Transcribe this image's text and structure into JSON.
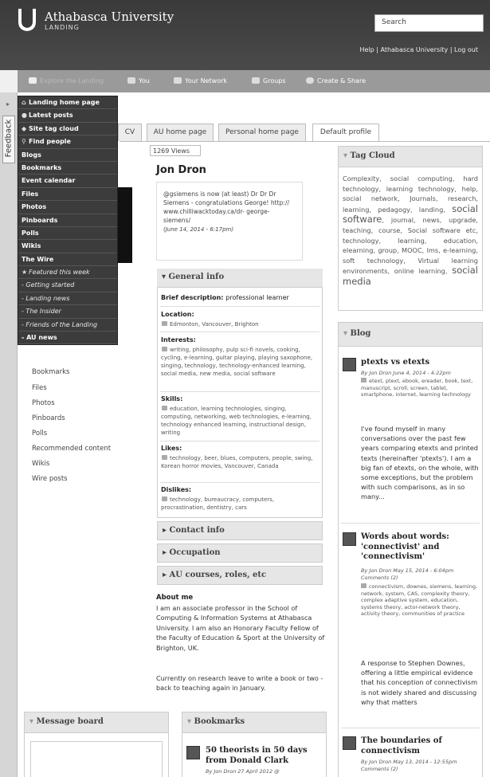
{
  "header": {
    "brand_name": "Athabasca University",
    "brand_sub": "LANDING",
    "search_placeholder": "Search",
    "top_links": "Help | Athabasca University | Log out"
  },
  "navbar": {
    "items": [
      "Explore the Landing",
      "You",
      "Your Network",
      "Groups",
      "Create & Share"
    ]
  },
  "feedback_label": "Feedback",
  "menu": {
    "items": [
      {
        "label": "Landing home page",
        "icon": "home-icon",
        "glyph": "⌂"
      },
      {
        "label": "Latest posts",
        "icon": "speech-bubble-icon",
        "glyph": "●"
      },
      {
        "label": "Site tag cloud",
        "icon": "tag-icon",
        "glyph": "◆"
      },
      {
        "label": "Find people",
        "icon": "search-icon",
        "glyph": "⚲"
      },
      {
        "label": "Blogs"
      },
      {
        "label": "Bookmarks"
      },
      {
        "label": "Event calendar"
      },
      {
        "label": "Files"
      },
      {
        "label": "Photos"
      },
      {
        "label": "Pinboards"
      },
      {
        "label": "Polls"
      },
      {
        "label": "Wikis"
      },
      {
        "label": "The Wire"
      },
      {
        "label": "Featured this week",
        "icon": "star-icon",
        "glyph": "★",
        "featured": true
      },
      {
        "label": "- Getting started",
        "featured": true
      },
      {
        "label": "- Landing news",
        "featured": true
      },
      {
        "label": "- The Insider",
        "featured": true
      },
      {
        "label": "- Friends of the Landing",
        "featured": true
      },
      {
        "label": "- AU news"
      }
    ]
  },
  "tabs": [
    "CV",
    "AU home page",
    "Personal home page",
    "Default profile"
  ],
  "sidebar_links": [
    "Bookmarks",
    "Files",
    "Photos",
    "Pinboards",
    "Polls",
    "Recommended content",
    "Wikis",
    "Wire posts"
  ],
  "profile": {
    "views": "1269 Views",
    "name": "Jon Dron",
    "status": "@gsiemens is now (at least) Dr Dr Dr Siemens - congratulations George! http:// www.chilliwacktoday.ca/dr- george-siemens/",
    "status_date": "(June 14, 2014 - 6:17pm)",
    "general_info": "General info",
    "brief_label": "Brief description:",
    "brief_value": "professional learner",
    "location_label": "Location:",
    "location_value": "Edmonton, Vancouver, Brighton",
    "interests_label": "Interests:",
    "interests_value": "writing, philosophy, pulp sci-fi novels, cooking, cycling, e-learning, guitar playing, playing saxophone, singing, technology, technology-enhanced learning, social media, new media, social software",
    "skills_label": "Skills:",
    "skills_value": "education, learning technologies, singing, computing, networking, web technologies, e-learning, technology enhanced learning, instructional design, writing",
    "likes_label": "Likes:",
    "likes_value": "technology, beer, blues, computers, people, swing, Korean horror movies, Vancouver, Canada",
    "dislikes_label": "Dislikes:",
    "dislikes_value": "technology, bureaucracy, computers, procrastination, dentistry, cars",
    "contact_info": "Contact info",
    "occupation": "Occupation",
    "au_courses": "AU courses, roles, etc",
    "about_label": "About me",
    "about_p1": "I am an associate professor in the School of Computing & Information Systems at Athabasca University. I am also an Honorary Faculty Fellow of the Faculty of Education & Sport at the University of Brighton, UK.",
    "about_p2": "Currently on research leave to write a book or two - back to teaching again in January."
  },
  "tag_cloud": {
    "title": "Tag Cloud",
    "t1": "Complexity, social computing, hard technology, learning technology, help, social network, Journals, research, learning, pedagogy, landing,",
    "big1": "social software",
    "t2": ", journal, news, upgrade, teaching, course, Social software etc, technology, learning, education, elearning, group, MOOC, lms, e-learning, soft technology, Virtual learning environments, online learning,",
    "big2": "social media"
  },
  "blog": {
    "title": "Blog",
    "posts": [
      {
        "title": "ptexts vs etexts",
        "meta": "By Jon Dron June 4, 2014 - 4:22pm",
        "tags": "etext, ptext, ebook, ereader, book, text, manuscript, scroll, screen, tablet, smartphone, internet, learning technology",
        "body": "I've found myself in many conversations over the past few years comparing etexts and printed texts (hereinafter 'ptexts'). I am a big fan of etexts, on the whole, with some exceptions, but the problem with such comparisons, as in so many..."
      },
      {
        "title": "Words about words: 'connectivist' and 'connectivism'",
        "meta": "By Jon Dron May 15, 2014 - 6:04pm Comments (2)",
        "tags": "connectivism, downes, siemens, learning, network, system, CAS, complexity theory, complex adaptive system, education, systems theory, actor-network theory, activity theory, communities of practice",
        "body": "A response to Stephen Downes, offering a little empirical evidence that his conception of connectivism is not widely shared and discussing why that matters"
      },
      {
        "title": "The boundaries of connectivism",
        "meta": "By Jon Dron May 13, 2014 - 12:55pm Comments (2)"
      }
    ]
  },
  "message_board": {
    "title": "Message board"
  },
  "bookmarks_box": {
    "title": "Bookmarks",
    "item_title": "50 theorists in 50 days from Donald Clark",
    "item_meta": "By Jon Dron 27 April 2012 @"
  }
}
